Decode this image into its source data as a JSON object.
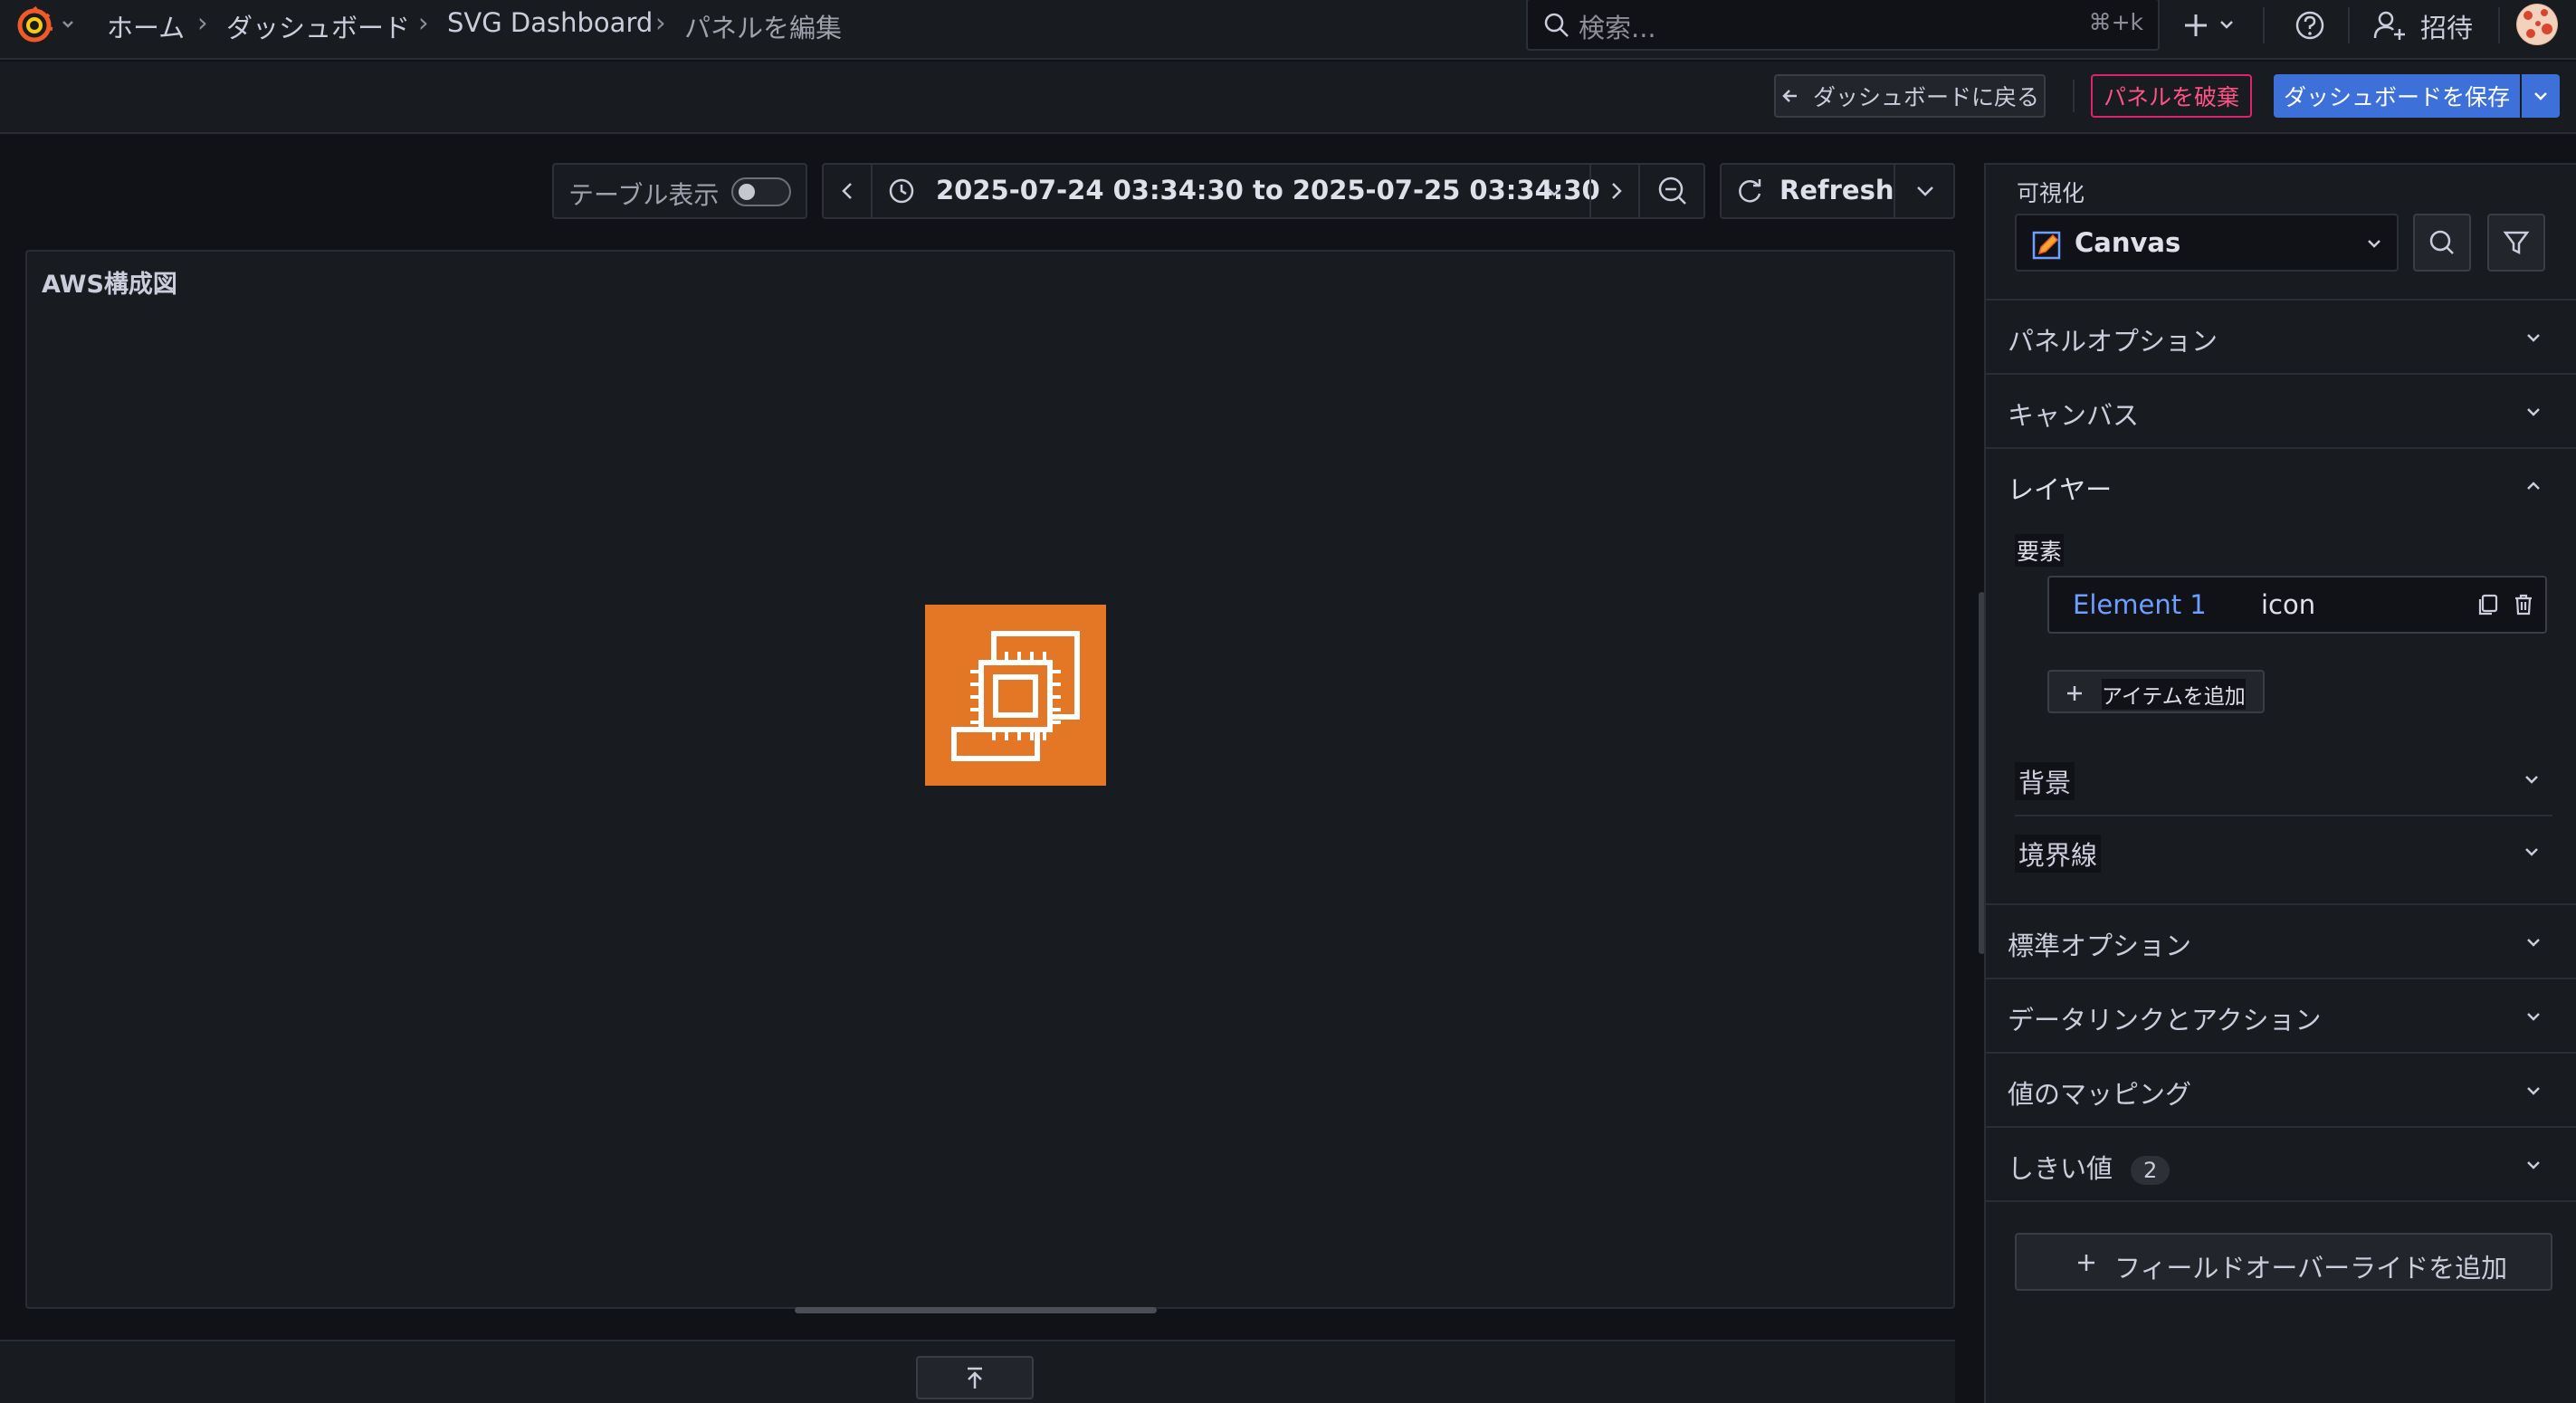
{
  "breadcrumb": {
    "home": "ホーム",
    "dashboards": "ダッシュボード",
    "dashboard": "SVG Dashboard",
    "current": "パネルを編集",
    "separator": "›"
  },
  "search": {
    "placeholder": "検索...",
    "shortcut": "⌘+k"
  },
  "nav": {
    "invite_label": "招待"
  },
  "edit_actions": {
    "back_label": "ダッシュボードに戻る",
    "discard_label": "パネルを破棄",
    "save_label": "ダッシュボードを保存"
  },
  "toolbar": {
    "table_view_label": "テーブル表示",
    "table_view_enabled": false,
    "time_range": "2025-07-24 03:34:30 to 2025-07-25 03:34:30",
    "refresh_label": "Refresh"
  },
  "panel": {
    "title": "AWS構成図",
    "icon": "aws-ec2-icon",
    "icon_color": "#e37726"
  },
  "options": {
    "visualization_label": "可視化",
    "visualization_value": "Canvas",
    "sections": {
      "panel_options": "パネルオプション",
      "canvas": "キャンバス",
      "layers": "レイヤー",
      "standard_options": "標準オプション",
      "data_links": "データリンクとアクション",
      "value_mappings": "値のマッピング",
      "thresholds": "しきい値",
      "thresholds_count": "2"
    },
    "elements_label": "要素",
    "elements": [
      {
        "name": "Element 1",
        "type": "icon"
      }
    ],
    "add_item_label": "アイテムを追加",
    "background_label": "背景",
    "border_label": "境界線",
    "add_override_label": "フィールドオーバーライドを追加"
  },
  "colors": {
    "primary": "#3d71d9",
    "destructive": "#e0226e",
    "link": "#6e9fff"
  }
}
